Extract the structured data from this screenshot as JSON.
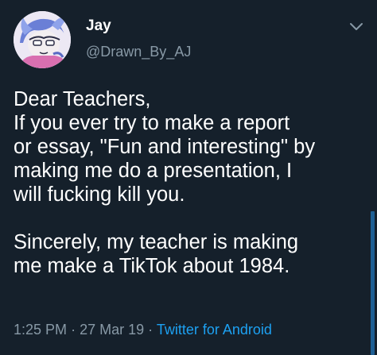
{
  "user": {
    "display_name": "Jay",
    "handle": "@Drawn_By_AJ"
  },
  "tweet": {
    "lines": [
      "Dear Teachers,",
      "If you ever try to make a report",
      "or essay, \"Fun and interesting\" by",
      "making me do a presentation, I",
      "will fucking kill you.",
      "",
      "Sincerely, my teacher is making",
      "me make a TikTok about 1984."
    ],
    "time": "1:25 PM",
    "separator": "·",
    "date": "27 Mar 19",
    "source": "Twitter for Android"
  },
  "icons": {
    "menu": "chevron-down-icon",
    "avatar": "avatar-illustration"
  },
  "colors": {
    "background": "#15202b",
    "text": "#ffffff",
    "secondary": "#8899a6",
    "link": "#1da1f2"
  }
}
